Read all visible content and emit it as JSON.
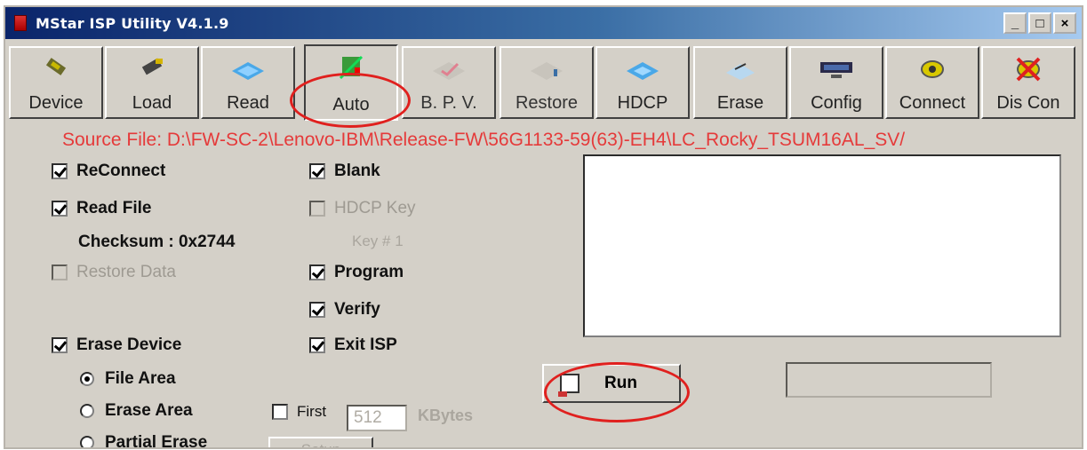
{
  "window": {
    "title": "MStar ISP Utility V4.1.9",
    "controls": [
      "_",
      "□",
      "×"
    ]
  },
  "toolbar": {
    "buttons": [
      {
        "label": "Device",
        "icon": "device-chip-icon"
      },
      {
        "label": "Load",
        "icon": "load-chip-icon"
      },
      {
        "label": "Read",
        "icon": "read-board-icon"
      },
      {
        "label": "Auto",
        "icon": "auto-icon",
        "pressed": true
      },
      {
        "label": "B. P. V.",
        "icon": "bpv-icon",
        "disabled": true
      },
      {
        "label": "Restore",
        "icon": "restore-icon",
        "disabled": true
      },
      {
        "label": "HDCP",
        "icon": "hdcp-icon"
      },
      {
        "label": "Erase",
        "icon": "erase-icon"
      },
      {
        "label": "Config",
        "icon": "config-icon"
      },
      {
        "label": "Connect",
        "icon": "connect-icon"
      },
      {
        "label": "Dis Con",
        "icon": "disconnect-icon"
      }
    ]
  },
  "source_file": "Source File: D:\\FW-SC-2\\Lenovo-IBM\\Release-FW\\56G1133-59(63)-EH4\\LC_Rocky_TSUM16AL_SV/",
  "options": {
    "reconnect": "ReConnect",
    "read_file": "Read File",
    "checksum": "Checksum : 0x2744",
    "restore_data": "Restore Data",
    "erase_device": "Erase Device",
    "file_area": "File Area",
    "erase_area": "Erase Area",
    "partial_erase": "Partial Erase",
    "blank": "Blank",
    "hdcp_key": "HDCP Key",
    "key_no": "Key # 1",
    "program": "Program",
    "verify": "Verify",
    "exit_isp": "Exit ISP",
    "first": "First",
    "first_value": "512",
    "kbytes": "KBytes",
    "setup": "Setup"
  },
  "run": {
    "label": "Run"
  },
  "colors": {
    "source_text": "#e53a3a",
    "highlight": "#e0201e",
    "title_bar": "#0a246a"
  }
}
